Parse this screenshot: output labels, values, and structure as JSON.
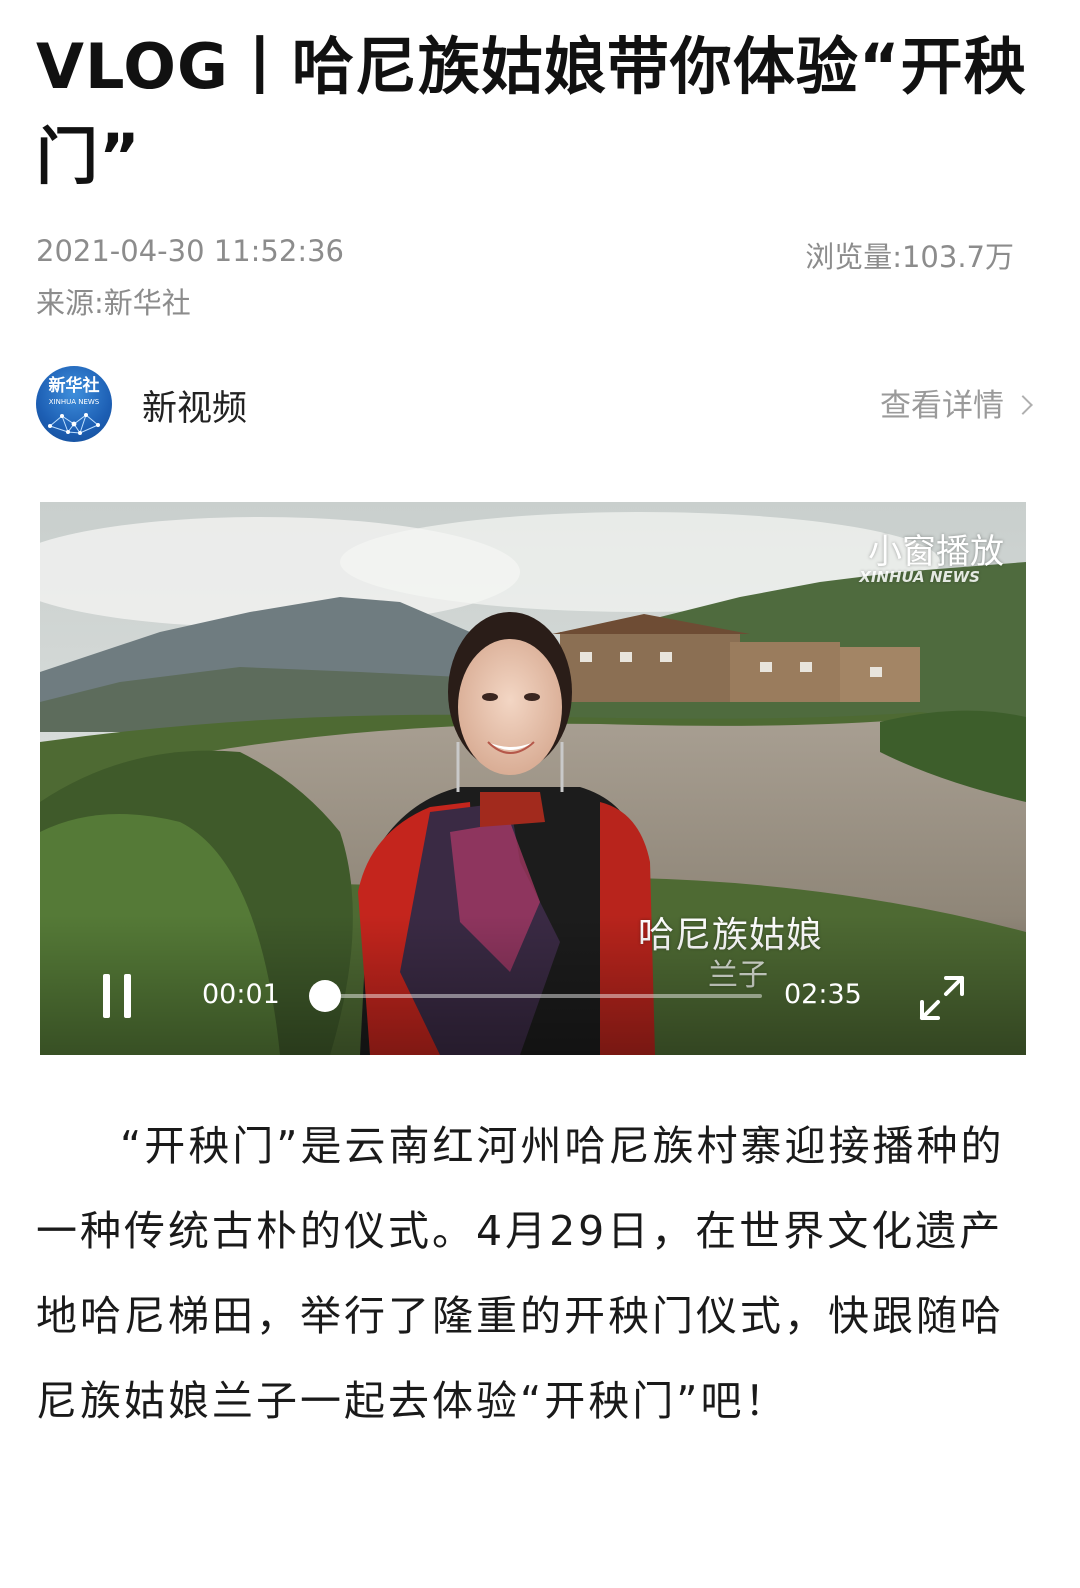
{
  "article": {
    "title": "VLOG丨哈尼族姑娘带你体验“开秧门”",
    "datetime": "2021-04-30 11:52:36",
    "views_label": "浏览量:",
    "views_value": "103.7万",
    "source_label": "来源:",
    "source_value": "新华社"
  },
  "channel": {
    "avatar_logo": "新华社",
    "avatar_logo_sub": "XINHUA NEWS",
    "name": "新视频",
    "detail_link": "查看详情"
  },
  "video": {
    "pip_label": "小窗播放",
    "watermark": "XINHUA NEWS",
    "caption_line1": "哈尼族姑娘",
    "caption_line2": "兰子",
    "time_current": "00:01",
    "time_total": "02:35",
    "progress_fraction": 0.0065,
    "controls": {
      "play_state_icon": "pause-icon",
      "fullscreen_icon": "fullscreen-icon"
    }
  },
  "body": {
    "paragraph": "“开秧门”是云南红河州哈尼族村寨迎接播种的一种传统古朴的仪式。4月29日，在世界文化遗产地哈尼梯田，举行了隆重的开秧门仪式，快跟随哈尼族姑娘兰子一起去体验“开秧门”吧！"
  },
  "colors": {
    "meta_text": "#8c8c8c",
    "avatar_blue": "#1d5fb4",
    "body_text": "#1a1a1a"
  }
}
